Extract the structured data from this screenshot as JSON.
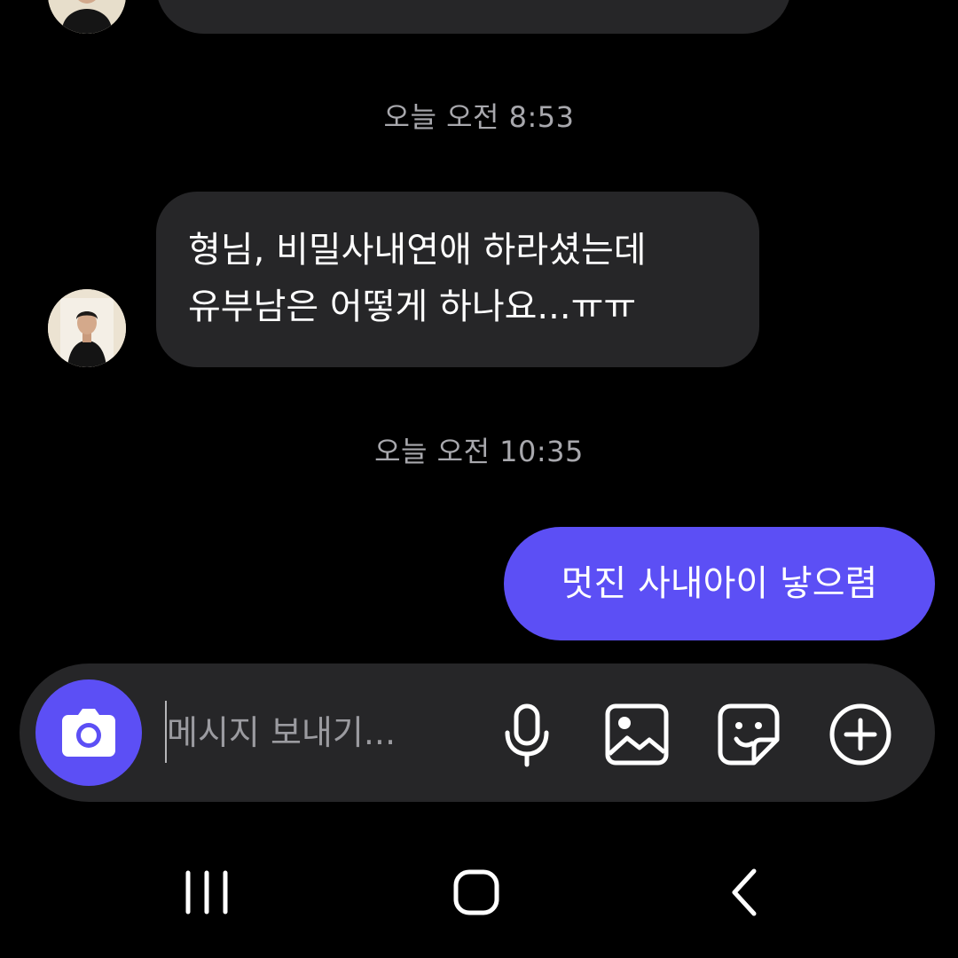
{
  "conversation": {
    "timestamps": [
      "오늘 오전 8:53",
      "오늘 오전 10:35"
    ],
    "incoming_message": "형님, 비밀사내연애 하라셨는데\n유부남은 어떻게 하나요...ㅠㅠ",
    "outgoing_message": "멋진 사내아이 낳으렴"
  },
  "composer": {
    "placeholder": "메시지 보내기..."
  },
  "icons": {
    "camera": "camera-icon",
    "microphone": "microphone-icon",
    "gallery": "image-gallery-icon",
    "sticker": "sticker-icon",
    "add": "plus-circle-icon",
    "recents": "recents-icon",
    "home": "home-icon",
    "back": "back-icon"
  },
  "colors": {
    "background": "#000000",
    "incoming_bubble": "#262628",
    "outgoing_bubble": "#5c4ff5",
    "timestamp_text": "#a8a8ad",
    "accent": "#5c4ff5"
  }
}
